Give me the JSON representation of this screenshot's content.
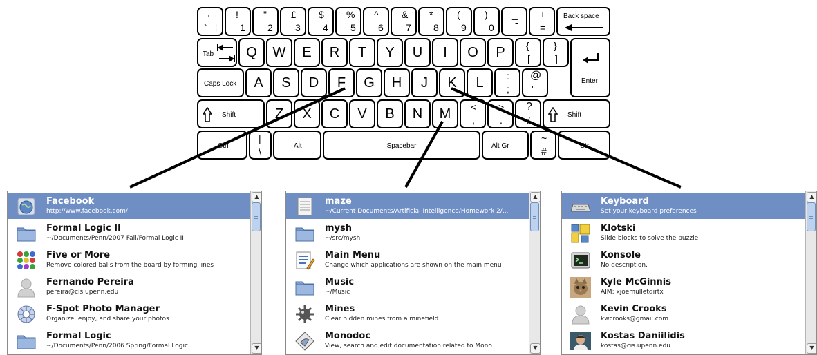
{
  "keyboard": {
    "row1": [
      {
        "top": "¬",
        "bottom": "`",
        "extra": "¦"
      },
      {
        "top": "!",
        "bottom": "1"
      },
      {
        "top": "\"",
        "bottom": "2"
      },
      {
        "top": "£",
        "bottom": "3"
      },
      {
        "top": "$",
        "bottom": "4"
      },
      {
        "top": "%",
        "bottom": "5"
      },
      {
        "top": "^",
        "bottom": "6"
      },
      {
        "top": "&",
        "bottom": "7"
      },
      {
        "top": "*",
        "bottom": "8"
      },
      {
        "top": "(",
        "bottom": "9"
      },
      {
        "top": ")",
        "bottom": "0"
      },
      {
        "top": "_",
        "bottom": "-"
      },
      {
        "top": "+",
        "bottom": "="
      }
    ],
    "backspace": "Back space",
    "tab": "Tab",
    "row2": [
      "Q",
      "W",
      "E",
      "R",
      "T",
      "Y",
      "U",
      "I",
      "O",
      "P"
    ],
    "bracket_open": {
      "top": "{",
      "bottom": "["
    },
    "bracket_close": {
      "top": "}",
      "bottom": "]"
    },
    "caps": "Caps Lock",
    "row3": [
      "A",
      "S",
      "D",
      "F",
      "G",
      "H",
      "J",
      "K",
      "L"
    ],
    "colon": {
      "top": ":",
      "bottom": ";"
    },
    "at": {
      "top": "@",
      "bottom": "'"
    },
    "enter": "Enter",
    "shift": "Shift",
    "row4": [
      "Z",
      "X",
      "C",
      "V",
      "B",
      "N",
      "M"
    ],
    "lt": {
      "top": "<",
      "bottom": ","
    },
    "gt": {
      "top": ">",
      "bottom": "."
    },
    "question": {
      "top": "?",
      "bottom": "/"
    },
    "ctrl": "Ctrl",
    "pipe": {
      "top": "|",
      "bottom": "\\"
    },
    "alt": "Alt",
    "spacebar": "Spacebar",
    "altgr": "Alt Gr",
    "hash": {
      "top": "~",
      "bottom": "#"
    }
  },
  "panels": [
    {
      "items": [
        {
          "title": "Facebook",
          "sub": "http://www.facebook.com/",
          "icon": "globe-icon",
          "selected": true
        },
        {
          "title": "Formal Logic II",
          "sub": "~/Documents/Penn/2007 Fall/Formal Logic II",
          "icon": "folder-icon"
        },
        {
          "title": "Five or More",
          "sub": "Remove colored balls from the board by forming lines",
          "icon": "colored-balls-icon"
        },
        {
          "title": "Fernando Pereira",
          "sub": "pereira@cis.upenn.edu",
          "icon": "person-icon"
        },
        {
          "title": "F-Spot Photo Manager",
          "sub": "Organize, enjoy, and share your photos",
          "icon": "photo-manager-icon"
        },
        {
          "title": "Formal Logic",
          "sub": "~/Documents/Penn/2006 Spring/Formal Logic",
          "icon": "folder-icon"
        }
      ]
    },
    {
      "items": [
        {
          "title": "maze",
          "sub": "~/Current Documents/Artificial Intelligence/Homework 2/...",
          "icon": "document-icon",
          "selected": true
        },
        {
          "title": "mysh",
          "sub": "~/src/mysh",
          "icon": "folder-icon"
        },
        {
          "title": "Main Menu",
          "sub": "Change which applications are shown on the main menu",
          "icon": "menu-editor-icon"
        },
        {
          "title": "Music",
          "sub": "~/Music",
          "icon": "folder-icon"
        },
        {
          "title": "Mines",
          "sub": "Clear hidden mines from a minefield",
          "icon": "mine-icon"
        },
        {
          "title": "Monodoc",
          "sub": "View, search and edit documentation related to Mono",
          "icon": "monodoc-icon"
        }
      ]
    },
    {
      "items": [
        {
          "title": "Keyboard",
          "sub": "Set your keyboard preferences",
          "icon": "keyboard-icon",
          "selected": true
        },
        {
          "title": "Klotski",
          "sub": "Slide blocks to solve the puzzle",
          "icon": "klotski-icon"
        },
        {
          "title": "Konsole",
          "sub": "No description.",
          "icon": "terminal-icon"
        },
        {
          "title": "Kyle McGinnis",
          "sub": "AIM: xjoemulletdirtx",
          "icon": "cat-avatar-icon"
        },
        {
          "title": "Kevin Crooks",
          "sub": "kwcrooks@gmail.com",
          "icon": "person-icon"
        },
        {
          "title": "Kostas Daniilidis",
          "sub": "kostas@cis.upenn.edu",
          "icon": "photo-avatar-icon"
        }
      ]
    }
  ],
  "colors": {
    "selected": "#6f8fc4",
    "border": "#8a8a8a"
  }
}
